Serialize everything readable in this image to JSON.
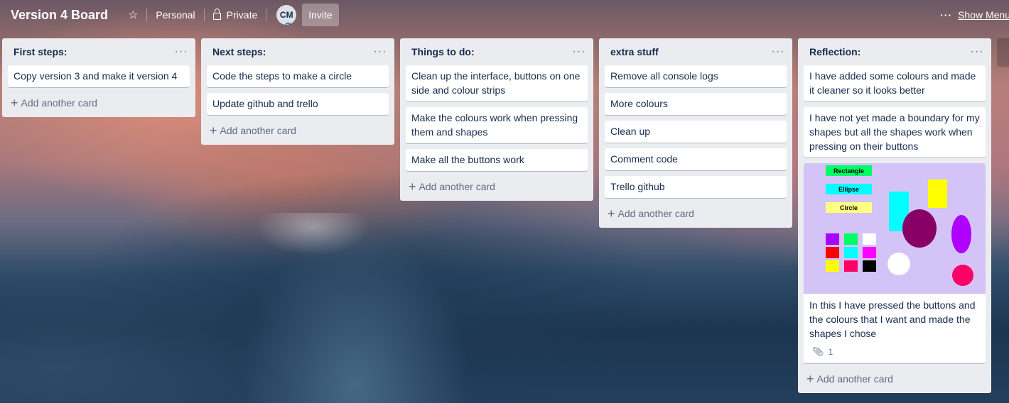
{
  "header": {
    "board_title": "Version 4 Board",
    "team_label": "Personal",
    "visibility_label": "Private",
    "avatar_initials": "CM",
    "invite_label": "Invite",
    "show_menu_label": "Show Menu"
  },
  "lists": [
    {
      "title": "First steps:",
      "cards": [
        "Copy version 3 and make it version 4"
      ],
      "add_label": "Add another card"
    },
    {
      "title": "Next steps:",
      "cards": [
        "Code the steps to make a circle",
        "Update github and trello"
      ],
      "add_label": "Add another card"
    },
    {
      "title": "Things to do:",
      "cards": [
        "Clean up the interface, buttons on one side and colour strips",
        "Make the colours work when pressing them and shapes",
        "Make all the buttons work"
      ],
      "add_label": "Add another card"
    },
    {
      "title": "extra stuff",
      "cards": [
        "Remove all console logs",
        "More colours",
        "Clean up",
        "Comment code",
        "Trello github"
      ],
      "add_label": "Add another card"
    },
    {
      "title": "Reflection:",
      "cards": [
        "I have added some colours and made it cleaner so it looks better",
        "I have not yet made a boundary for my shapes but all the shapes work when pressing on their buttons"
      ],
      "image_card": {
        "buttons": [
          "Rectangle",
          "Ellipse",
          "Circle"
        ],
        "text": "In this I have pressed the buttons and the colours that I want and made the shapes I chose",
        "attachment_count": "1"
      },
      "add_label": "Add another card"
    }
  ]
}
